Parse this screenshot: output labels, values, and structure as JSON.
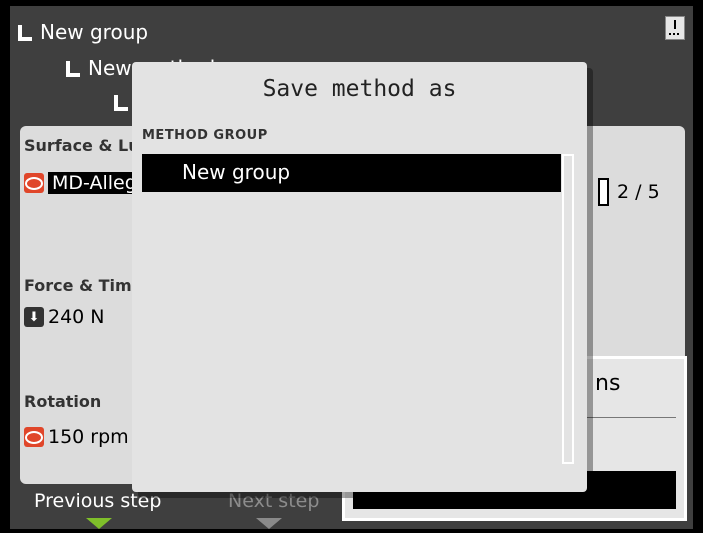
{
  "tree": {
    "level1": "New group",
    "level2": "New method",
    "level3": ""
  },
  "method_panel": {
    "surface_title": "Surface & Lubricant",
    "surface_value": "MD-Allegro",
    "step_counter": "2 / 5",
    "force_title": "Force & Time",
    "force_value": "240 N",
    "rotation_title": "Rotation",
    "rotation_value": "150 rpm"
  },
  "bottom_bar": {
    "previous_step": "Previous step",
    "next_step": "Next step",
    "accent": "#7fbf2a"
  },
  "second_dialog": {
    "title_fragment": "ns"
  },
  "save_dialog": {
    "title": "Save method as",
    "group_label": "METHOD GROUP",
    "groups": [
      "New group"
    ],
    "selected_index": 0
  },
  "icons": [
    "download-icon",
    "surface-icon",
    "force-arrow-icon",
    "rotation-icon"
  ]
}
